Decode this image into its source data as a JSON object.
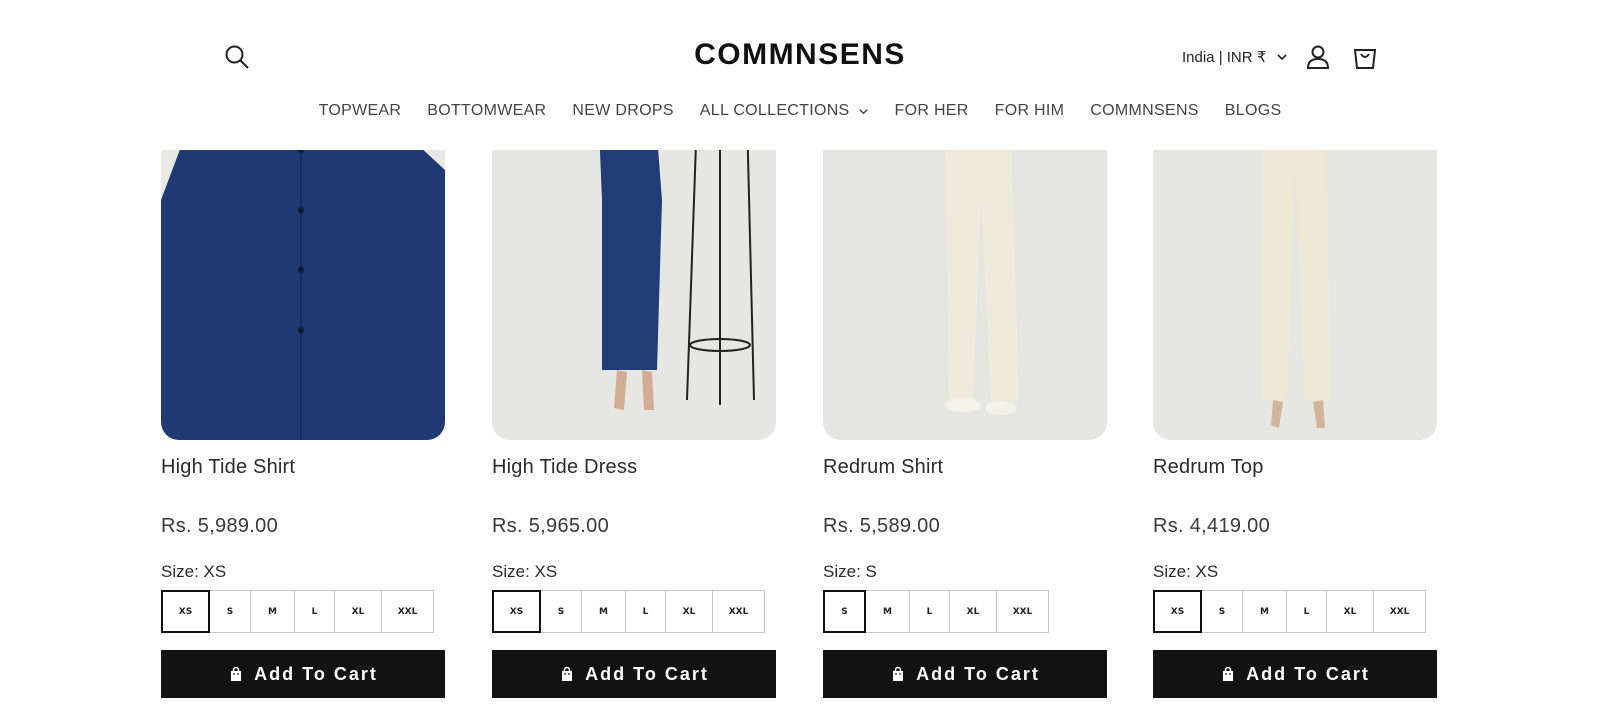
{
  "header": {
    "logo": "COMMNSENS",
    "locale": "India | INR ₹",
    "icons": [
      "search-icon",
      "chevron-down-icon",
      "account-icon",
      "cart-icon"
    ]
  },
  "nav": {
    "items": [
      {
        "label": "TOPWEAR"
      },
      {
        "label": "BOTTOMWEAR"
      },
      {
        "label": "NEW DROPS"
      },
      {
        "label": "ALL COLLECTIONS",
        "has_dropdown": true
      },
      {
        "label": "FOR HER"
      },
      {
        "label": "FOR HIM"
      },
      {
        "label": "COMMNSENS"
      },
      {
        "label": "BLOGS"
      }
    ]
  },
  "products": [
    {
      "title": "High Tide Shirt",
      "price": "Rs. 5,989.00",
      "size_label": "Size: XS",
      "sizes": [
        "XS",
        "S",
        "M",
        "L",
        "XL",
        "XXL"
      ],
      "selected": "XS",
      "cta": "Add To Cart"
    },
    {
      "title": "High Tide Dress",
      "price": "Rs. 5,965.00",
      "size_label": "Size: XS",
      "sizes": [
        "XS",
        "S",
        "M",
        "L",
        "XL",
        "XXL"
      ],
      "selected": "XS",
      "cta": "Add To Cart"
    },
    {
      "title": "Redrum Shirt",
      "price": "Rs. 5,589.00",
      "size_label": "Size: S",
      "sizes": [
        "S",
        "M",
        "L",
        "XL",
        "XXL"
      ],
      "selected": "S",
      "cta": "Add To Cart"
    },
    {
      "title": "Redrum Top",
      "price": "Rs. 4,419.00",
      "size_label": "Size: XS",
      "sizes": [
        "XS",
        "S",
        "M",
        "L",
        "XL",
        "XXL"
      ],
      "selected": "XS",
      "cta": "Add To Cart"
    }
  ],
  "colors": {
    "button_bg": "#121212",
    "navy": "#1f3a72",
    "maroon": "#6a1a1f",
    "photo_bg": "#e7e8e3"
  }
}
